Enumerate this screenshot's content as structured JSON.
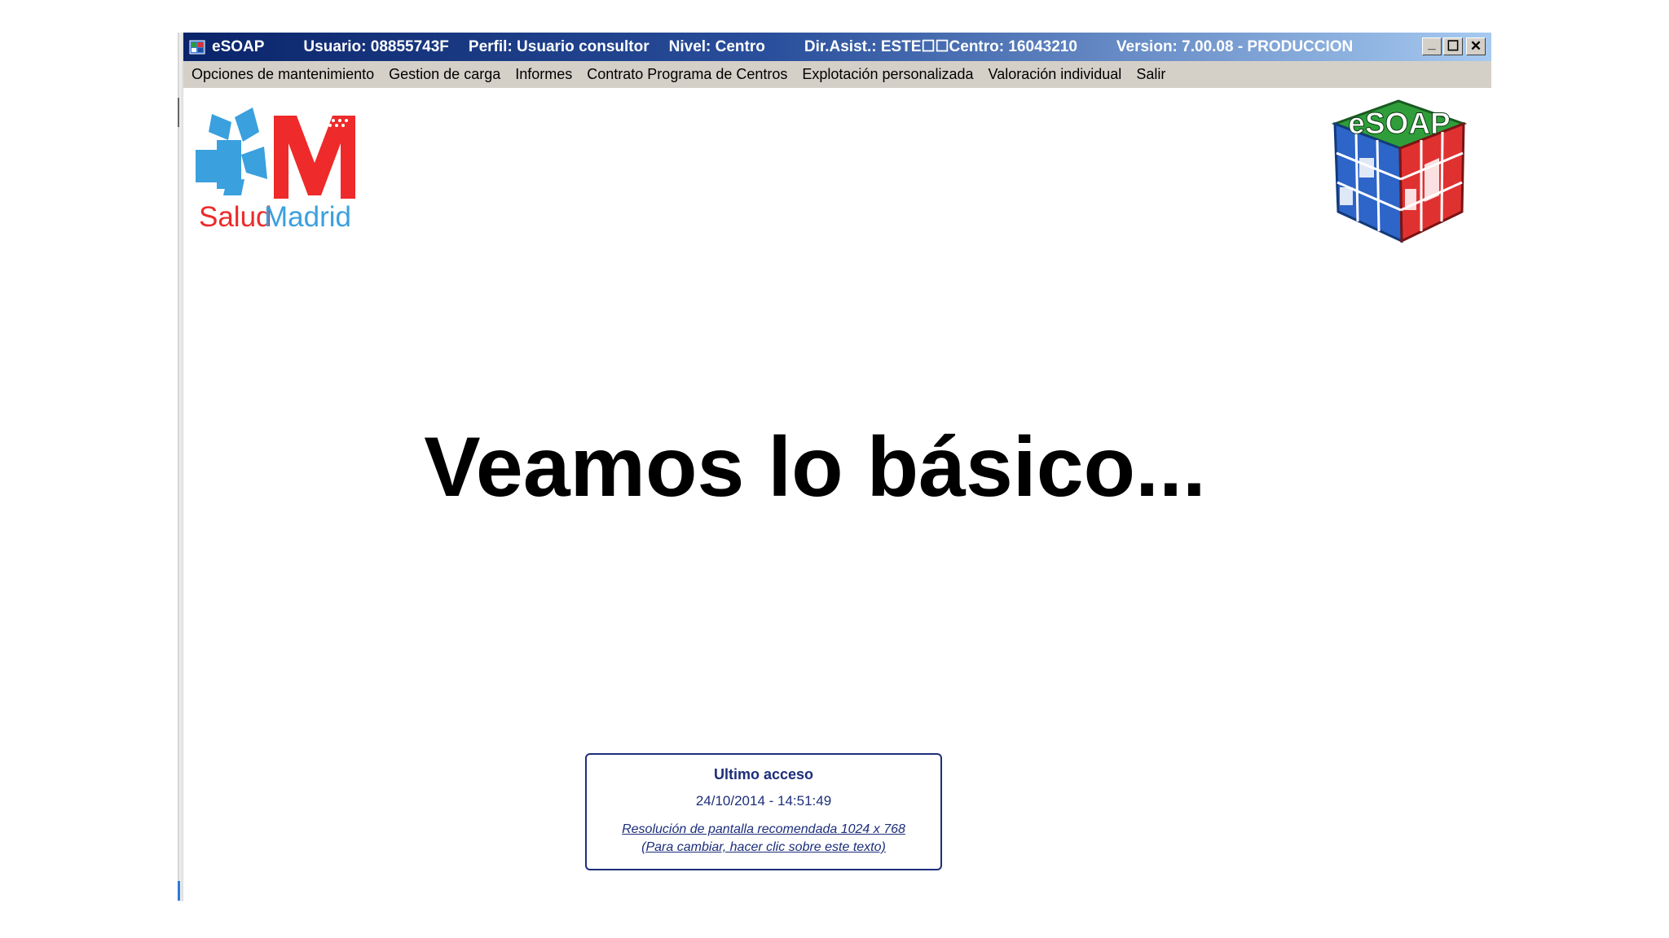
{
  "titlebar": {
    "app_name": "eSOAP",
    "usuario": "Usuario: 08855743F",
    "perfil": "Perfil: Usuario consultor",
    "nivel": "Nivel: Centro",
    "dir_asist": "Dir.Asist.: ESTE☐☐Centro: 16043210",
    "version": "Version: 7.00.08 - PRODUCCION",
    "minimize": "_",
    "maximize": "☐",
    "close": "✕",
    "gradient_start": "#0a246a",
    "gradient_end": "#a6caf0"
  },
  "menu": {
    "items": [
      "Opciones de mantenimiento",
      "Gestion de carga",
      "Informes",
      "Contrato Programa de Centros",
      "Explotación personalizada",
      "Valoración individual",
      "Salir"
    ]
  },
  "logos": {
    "salud_madrid": {
      "salud": "Salud",
      "madrid": "Madrid",
      "red": "#ee2a2a",
      "blue": "#3aa0de"
    },
    "esoap": {
      "text": "eSOAP"
    }
  },
  "headline": "Veamos lo básico...",
  "last_access": {
    "title": "Ultimo acceso",
    "datetime": "24/10/2014 - 14:51:49",
    "resolution_link": "Resolución de pantalla  recomendada 1024 x 768",
    "change_hint": "(Para cambiar, hacer clic sobre este texto)"
  }
}
